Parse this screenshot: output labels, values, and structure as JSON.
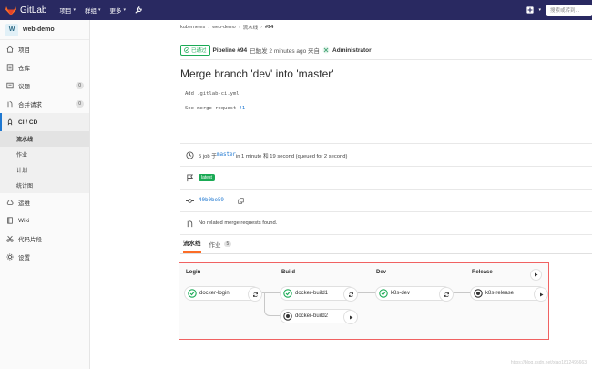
{
  "topbar": {
    "brand": "GitLab",
    "nav": [
      "项目",
      "群组",
      "更多"
    ],
    "search_placeholder": "搜索或转到..."
  },
  "sidebar": {
    "project_initial": "W",
    "project_name": "web-demo",
    "items": [
      {
        "label": "项目",
        "icon": "home-icon"
      },
      {
        "label": "仓库",
        "icon": "doc-icon"
      },
      {
        "label": "议题",
        "icon": "issues-icon",
        "badge": "0"
      },
      {
        "label": "合并请求",
        "icon": "merge-request-icon",
        "badge": "0"
      },
      {
        "label": "CI / CD",
        "icon": "rocket-icon",
        "active": true
      },
      {
        "label": "运维",
        "icon": "cloud-icon"
      },
      {
        "label": "Wiki",
        "icon": "book-icon"
      },
      {
        "label": "代码片段",
        "icon": "scissors-icon"
      },
      {
        "label": "设置",
        "icon": "gear-icon"
      }
    ],
    "cicd_sub": [
      "流水线",
      "作业",
      "计划",
      "统计图"
    ]
  },
  "breadcrumbs": [
    "kubernetes",
    "web-demo",
    "流水线",
    "#94"
  ],
  "pipeline": {
    "status": "已通过",
    "id_label": "Pipeline #94",
    "triggered": "已触发 2 minutes ago 来自",
    "user": "Administrator"
  },
  "commit": {
    "title": "Merge branch 'dev' into 'master'",
    "line1": "Add .gitlab-ci.yml",
    "line2_prefix": "See merge request ",
    "line2_link": "!1"
  },
  "info": {
    "jobs_prefix": "5 job 于",
    "branch": "master",
    "jobs_suffix": " in 1 minute 和 19 second (queued for 2 second)",
    "tag": "latest",
    "sha": "40b0be59",
    "mr_text": "No related merge requests found."
  },
  "tabs": [
    {
      "label": "流水线",
      "active": true
    },
    {
      "label": "作业",
      "count": "5"
    }
  ],
  "stages": [
    {
      "name": "Login",
      "jobs": [
        {
          "name": "docker-login",
          "status": "passed"
        }
      ]
    },
    {
      "name": "Build",
      "jobs": [
        {
          "name": "docker-build1",
          "status": "passed"
        },
        {
          "name": "docker-build2",
          "status": "manual"
        }
      ]
    },
    {
      "name": "Dev",
      "jobs": [
        {
          "name": "k8s-dev",
          "status": "passed"
        }
      ]
    },
    {
      "name": "Release",
      "jobs": [
        {
          "name": "k8s-release",
          "status": "manual"
        }
      ]
    }
  ],
  "watermark": "https://blog.csdn.net/xiao1812495663",
  "colors": {
    "topbar": "#292961",
    "success": "#1aaa55",
    "link": "#1f78d1",
    "highlight": "#f06262"
  }
}
